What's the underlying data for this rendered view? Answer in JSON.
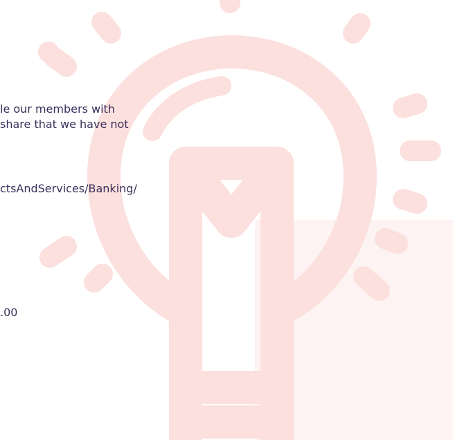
{
  "content": {
    "lines": [
      "le our members with",
      "share that we have not",
      "ctsAndServices/Banking/",
      ".00"
    ]
  },
  "colors": {
    "text": "#3a2f5b",
    "bulb": "#fbe0dd",
    "panel": "#fdf3f2"
  },
  "icons": {
    "background": "lightbulb-icon"
  }
}
